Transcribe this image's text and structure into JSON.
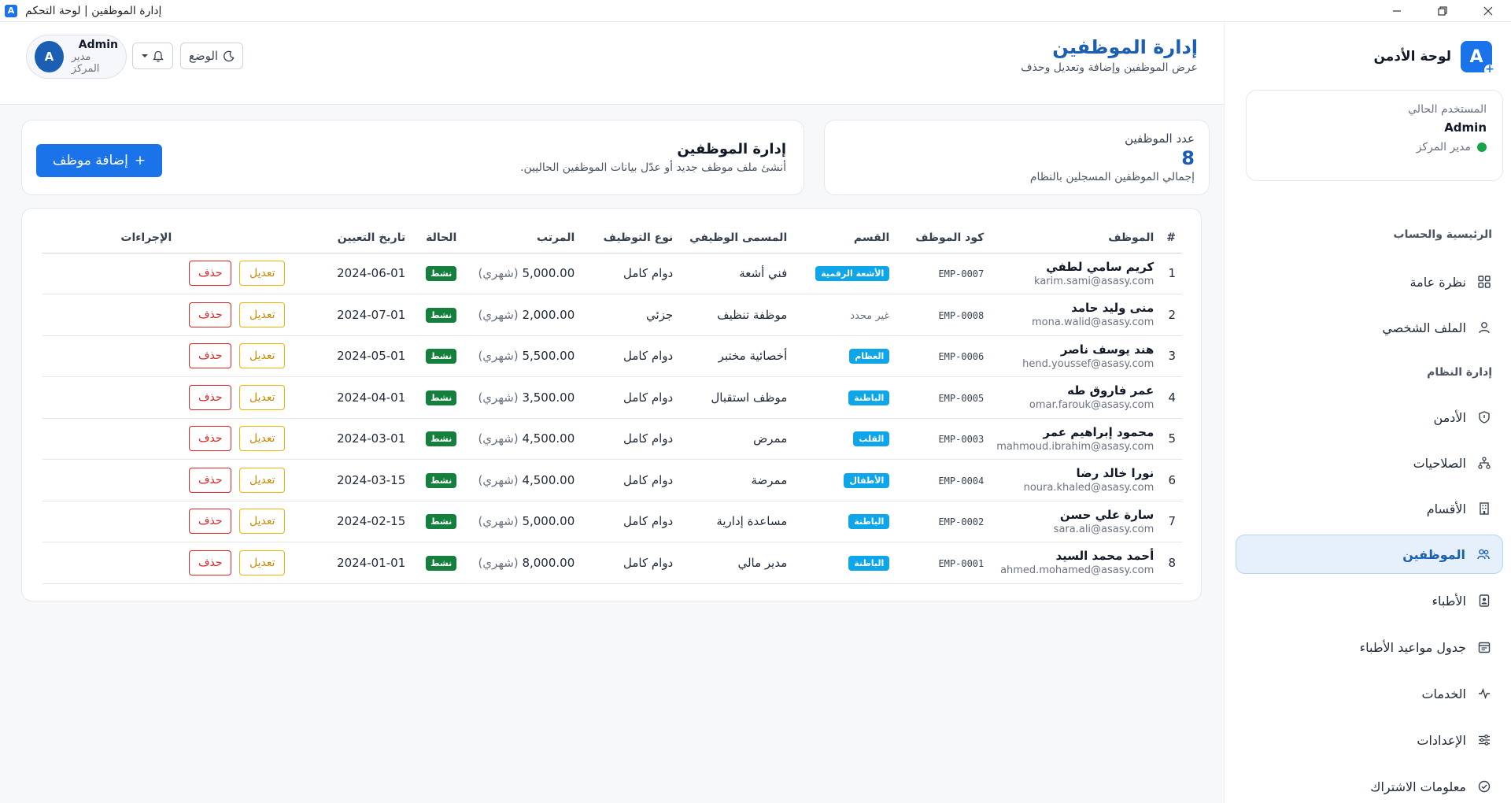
{
  "window": {
    "title": "إدارة الموظفين | لوحة التحكم",
    "app_icon_letter": "A"
  },
  "sidebar": {
    "brand_name": "لوحة الأدمن",
    "brand_letter": "A",
    "user_card": {
      "label": "المستخدم الحالي",
      "name": "Admin",
      "role": "مدير المركز"
    },
    "sections": [
      {
        "title": "الرئيسية والحساب"
      },
      {
        "title": "إدارة النظام"
      }
    ],
    "items": [
      {
        "label": "نظرة عامة",
        "icon": "grid-icon"
      },
      {
        "label": "الملف الشخصي",
        "icon": "user-icon"
      },
      {
        "label": "الأدمن",
        "icon": "shield-icon"
      },
      {
        "label": "الصلاحيات",
        "icon": "hierarchy-icon"
      },
      {
        "label": "الأقسام",
        "icon": "building-icon"
      },
      {
        "label": "الموظفين",
        "icon": "users-icon"
      },
      {
        "label": "الأطباء",
        "icon": "id-badge-icon"
      },
      {
        "label": "جدول مواعيد الأطباء",
        "icon": "calendar-icon"
      },
      {
        "label": "الخدمات",
        "icon": "pulse-icon"
      },
      {
        "label": "الإعدادات",
        "icon": "sliders-icon"
      },
      {
        "label": "معلومات الاشتراك",
        "icon": "check-circle-icon"
      }
    ],
    "active_item": "الموظفين"
  },
  "header": {
    "title": "إدارة الموظفين",
    "subtitle": "عرض الموظفين وإضافة وتعديل وحذف",
    "mode_label": "الوضع",
    "profile": {
      "avatar_letter": "A",
      "name": "Admin",
      "role": "مدير المركز"
    }
  },
  "count_card": {
    "label": "عدد الموظفين",
    "value": "8",
    "subtitle": "إجمالي الموظفين المسجلين بالنظام"
  },
  "manage_card": {
    "title": "إدارة الموظفين",
    "subtitle": "أنشئ ملف موظف جديد أو عدّل بيانات الموظفين الحاليين.",
    "add_button": "إضافة موظف",
    "add_button_icon": "+"
  },
  "table": {
    "columns": [
      "#",
      "الموظف",
      "كود الموظف",
      "القسم",
      "المسمى الوظيفي",
      "نوع التوظيف",
      "المرتب",
      "الحالة",
      "تاريخ التعيين",
      "الإجراءات"
    ],
    "edit_label": "تعديل",
    "delete_label": "حذف",
    "salary_period": "(شهري)",
    "rows": [
      {
        "num": "1",
        "name": "كريم سامي لطفي",
        "email": "karim.sami@asasy.com",
        "code": "EMP-0007",
        "dept": "الأشعة الرقمية",
        "title": "فني أشعة",
        "type": "دوام كامل",
        "salary": "5,000.00",
        "status": "نشط",
        "date": "2024-06-01"
      },
      {
        "num": "2",
        "name": "منى وليد حامد",
        "email": "mona.walid@asasy.com",
        "code": "EMP-0008",
        "dept": "غير محدد",
        "title": "موظفة تنظيف",
        "type": "جزئي",
        "salary": "2,000.00",
        "status": "نشط",
        "date": "2024-07-01"
      },
      {
        "num": "3",
        "name": "هند يوسف ناصر",
        "email": "hend.youssef@asasy.com",
        "code": "EMP-0006",
        "dept": "العظام",
        "title": "أخصائية مختبر",
        "type": "دوام كامل",
        "salary": "5,500.00",
        "status": "نشط",
        "date": "2024-05-01"
      },
      {
        "num": "4",
        "name": "عمر فاروق طه",
        "email": "omar.farouk@asasy.com",
        "code": "EMP-0005",
        "dept": "الباطنة",
        "title": "موظف استقبال",
        "type": "دوام كامل",
        "salary": "3,500.00",
        "status": "نشط",
        "date": "2024-04-01"
      },
      {
        "num": "5",
        "name": "محمود إبراهيم عمر",
        "email": "mahmoud.ibrahim@asasy.com",
        "code": "EMP-0003",
        "dept": "القلب",
        "title": "ممرض",
        "type": "دوام كامل",
        "salary": "4,500.00",
        "status": "نشط",
        "date": "2024-03-01"
      },
      {
        "num": "6",
        "name": "نورا خالد رضا",
        "email": "noura.khaled@asasy.com",
        "code": "EMP-0004",
        "dept": "الأطفال",
        "title": "ممرضة",
        "type": "دوام كامل",
        "salary": "4,500.00",
        "status": "نشط",
        "date": "2024-03-15"
      },
      {
        "num": "7",
        "name": "سارة علي حسن",
        "email": "sara.ali@asasy.com",
        "code": "EMP-0002",
        "dept": "الباطنة",
        "title": "مساعدة إدارية",
        "type": "دوام كامل",
        "salary": "5,000.00",
        "status": "نشط",
        "date": "2024-02-15"
      },
      {
        "num": "8",
        "name": "أحمد محمد السيد",
        "email": "ahmed.mohamed@asasy.com",
        "code": "EMP-0001",
        "dept": "الباطنة",
        "title": "مدير مالي",
        "type": "دوام كامل",
        "salary": "8,000.00",
        "status": "نشط",
        "date": "2024-01-01"
      }
    ]
  },
  "colors": {
    "primary": "#1a73e8",
    "title_blue": "#1a5fb4",
    "dept_badge": "#0ea5e9",
    "status_active": "#15803d",
    "edit_yellow": "#eab308",
    "delete_red": "#dc2626"
  }
}
